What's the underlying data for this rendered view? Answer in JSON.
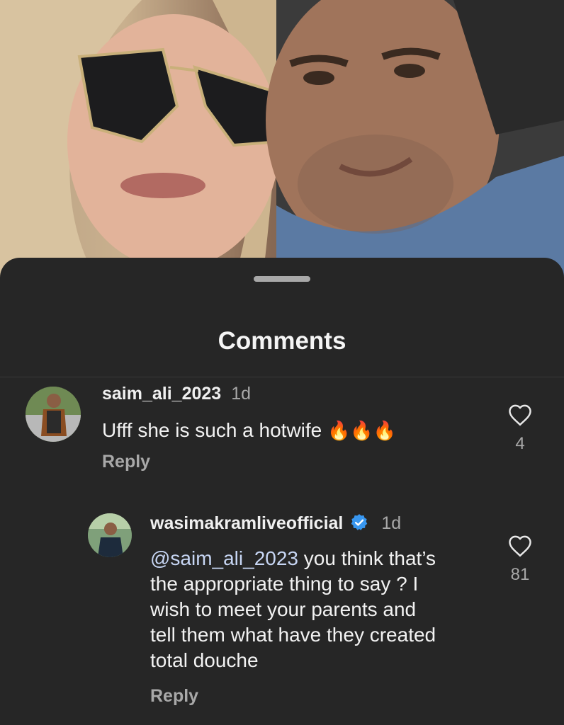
{
  "sheet": {
    "title": "Comments"
  },
  "comments": [
    {
      "username": "saim_ali_2023",
      "time": "1d",
      "text": "Ufff she is such a hotwife",
      "emojis": "🔥🔥🔥",
      "reply_label": "Reply",
      "like_count": "4"
    },
    {
      "username": "wasimakramliveofficial",
      "verified": true,
      "time": "1d",
      "mention": "@saim_ali_2023",
      "line1_rest": " you think that’s",
      "line2": "the appropriate thing to say ? I",
      "line3": "wish to meet your parents and",
      "line4": "tell them what have they created",
      "line5": "total douche",
      "reply_label": "Reply",
      "like_count": "81"
    }
  ],
  "icons": {
    "like": "heart-outline-icon",
    "verified": "verified-badge-icon",
    "handle": "drag-handle"
  },
  "colors": {
    "sheet_bg": "#262626",
    "verified_blue": "#3897f0",
    "mention": "#c7d6f4",
    "secondary_text": "#a8a8a8"
  }
}
